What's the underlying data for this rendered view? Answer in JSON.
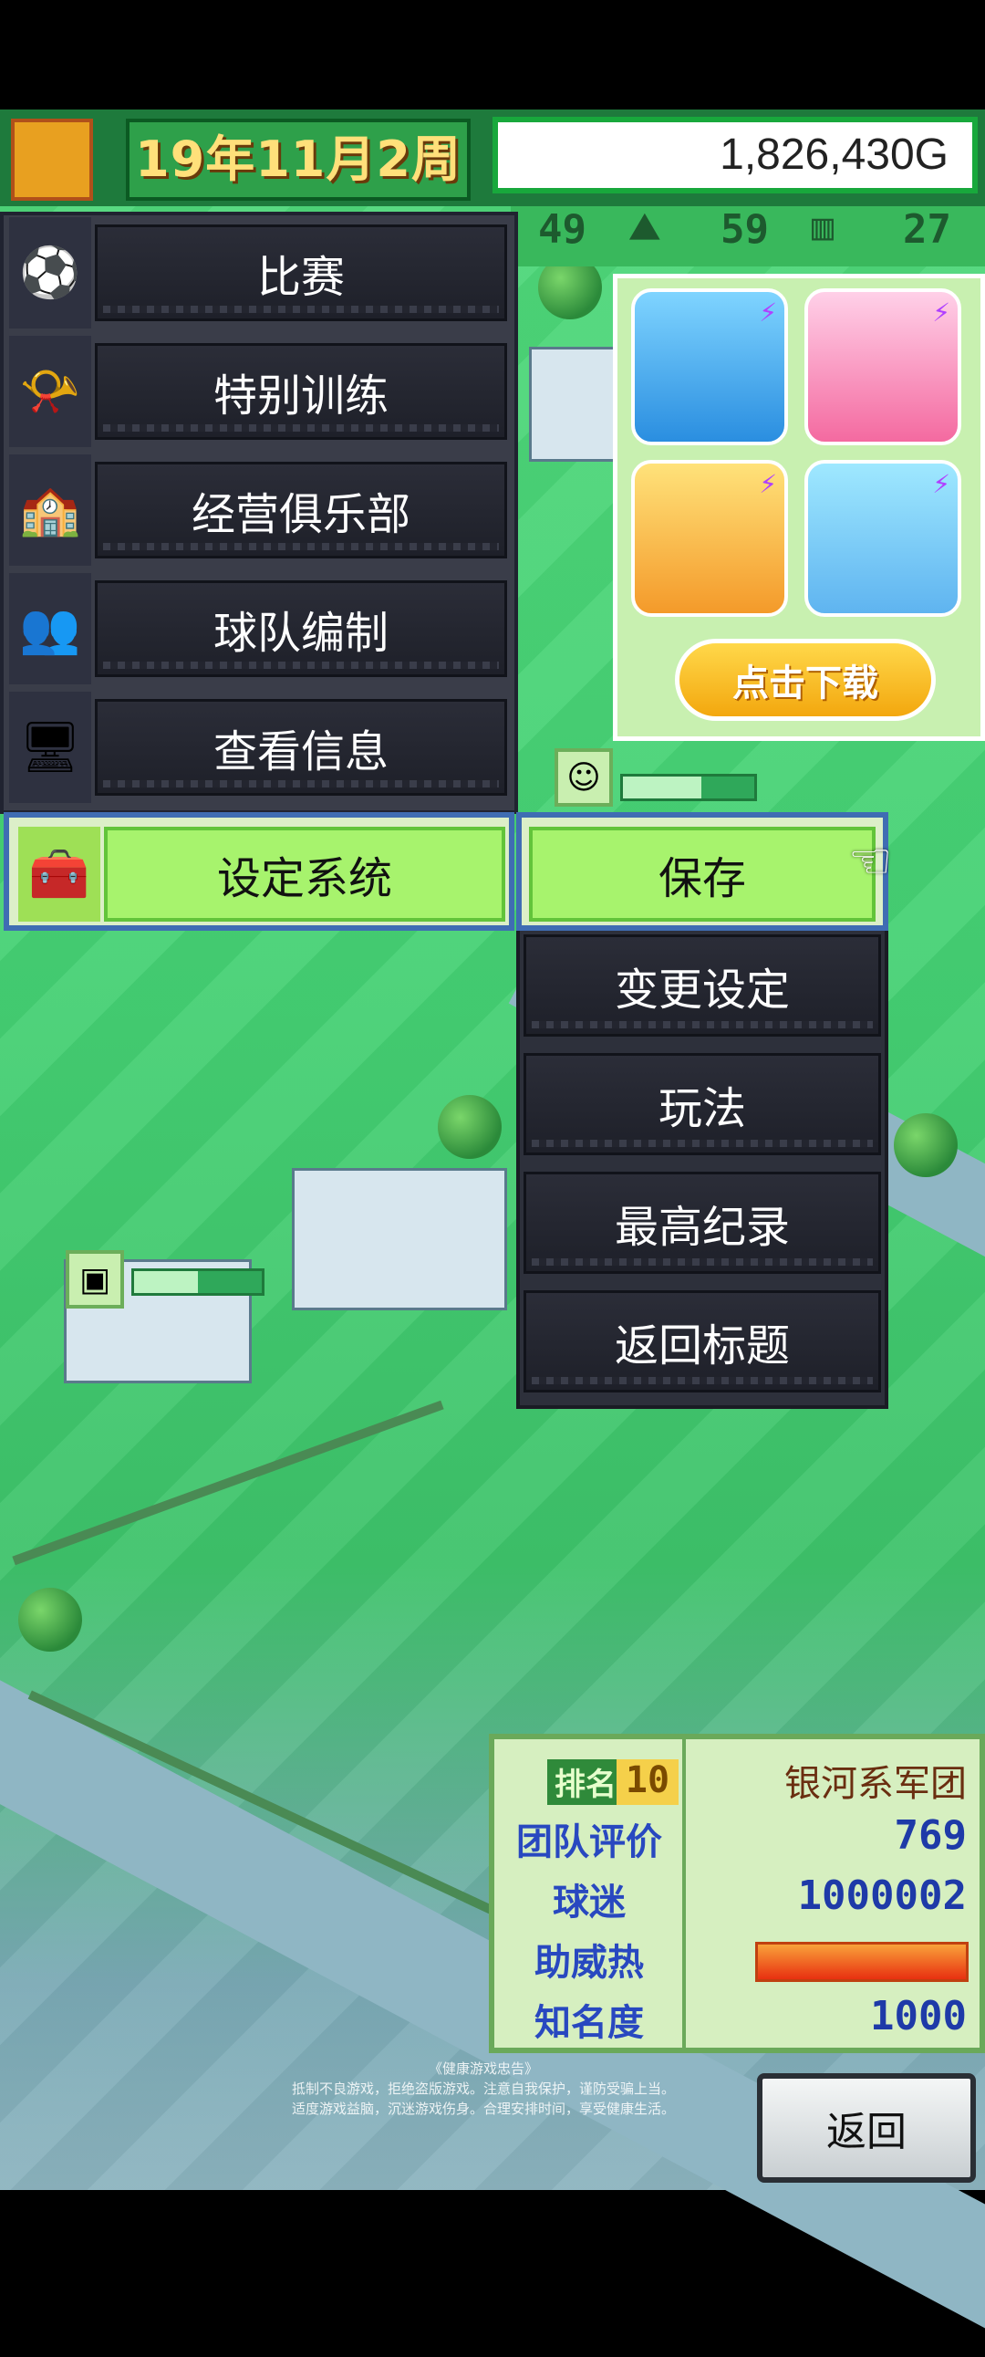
{
  "topbar": {
    "date": "19年11月2周",
    "money": "1,826,430G",
    "stats": [
      "49",
      "59",
      "27"
    ]
  },
  "menu": {
    "items": [
      {
        "label": "比赛",
        "icon": "soccer-ball-icon"
      },
      {
        "label": "特别训练",
        "icon": "whistle-icon"
      },
      {
        "label": "经营俱乐部",
        "icon": "clubhouse-icon"
      },
      {
        "label": "球队编制",
        "icon": "players-icon"
      },
      {
        "label": "查看信息",
        "icon": "computer-icon"
      }
    ],
    "active": {
      "label": "设定系统",
      "icon": "toolbox-icon"
    }
  },
  "submenu": {
    "save": "保存",
    "items": [
      "变更设定",
      "玩法",
      "最高纪录",
      "返回标题"
    ]
  },
  "ad": {
    "download_label": "点击下载"
  },
  "team": {
    "rank_label": "排名",
    "rank_value": "10",
    "name": "银河系军团",
    "rows": [
      {
        "label": "团队评价",
        "value": "769"
      },
      {
        "label": "球迷",
        "value": "1000002"
      },
      {
        "label": "助威热",
        "value": ""
      },
      {
        "label": "知名度",
        "value": "1000"
      }
    ],
    "cheer_level": 1.0
  },
  "notice": {
    "title": "《健康游戏忠告》",
    "line1": "抵制不良游戏，拒绝盗版游戏。注意自我保护，谨防受骗上当。",
    "line2": "适度游戏益脑，沉迷游戏伤身。合理安排时间，享受健康生活。"
  },
  "back_button": "返回",
  "colors": {
    "grass": "#45d174",
    "accent_green": "#a7f36d",
    "menu_dark": "#2b2d38",
    "highlight_border": "#3f6db3"
  }
}
